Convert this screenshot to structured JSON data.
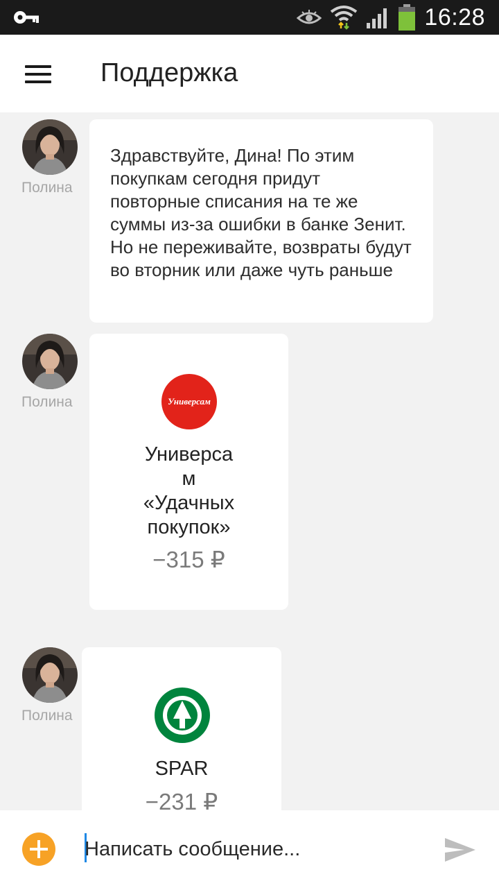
{
  "status_bar": {
    "time": "16:28",
    "icons": [
      "key-icon",
      "eye-icon",
      "wifi-icon",
      "signal-icon",
      "battery-icon"
    ]
  },
  "header": {
    "menu_icon": "hamburger-icon",
    "title": "Поддержка"
  },
  "messages": [
    {
      "sender": "Полина",
      "type": "text",
      "text": "Здравствуйте, Дина! По этим покупкам сегодня придут повторные списания на те же суммы из-за ошибки в банке Зенит. Но не переживайте, возвраты будут во вторник или даже чуть раньше"
    },
    {
      "sender": "Полина",
      "type": "purchase",
      "logo_text": "Универсам",
      "merchant_line1": "Универса",
      "merchant_line2": "м",
      "merchant_line3": "«Удачных",
      "merchant_line4": "покупок»",
      "amount": "−315 ₽"
    },
    {
      "sender": "Полина",
      "type": "purchase",
      "merchant": "SPAR",
      "amount": "−231 ₽"
    }
  ],
  "composer": {
    "placeholder": "Написать сообщение...",
    "add_icon": "plus-circle-icon",
    "send_icon": "send-icon"
  },
  "colors": {
    "accent": "#f7a226",
    "universam_red": "#e2231a",
    "spar_green": "#00843d",
    "background": "#f2f2f2"
  }
}
